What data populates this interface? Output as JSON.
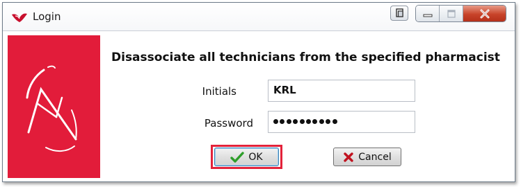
{
  "window": {
    "title": "Login",
    "app_icon": "red-wing-app-icon"
  },
  "titlebar_buttons": {
    "extra": "window-menu-icon",
    "minimize": "minimize-icon",
    "maximize": "maximize-icon",
    "close": "close-icon"
  },
  "dialog": {
    "heading": "Disassociate all technicians from the specified pharmacist",
    "initials_label": "Initials",
    "initials_value": "KRL",
    "password_label": "Password",
    "password_mask_count": 10,
    "ok_label": "OK",
    "ok_icon": "checkmark-icon",
    "cancel_label": "Cancel",
    "cancel_icon": "x-icon"
  },
  "colors": {
    "brand_red": "#e21c3a",
    "highlight_red": "#e3223a",
    "ok_check_green": "#2e9e2a"
  }
}
